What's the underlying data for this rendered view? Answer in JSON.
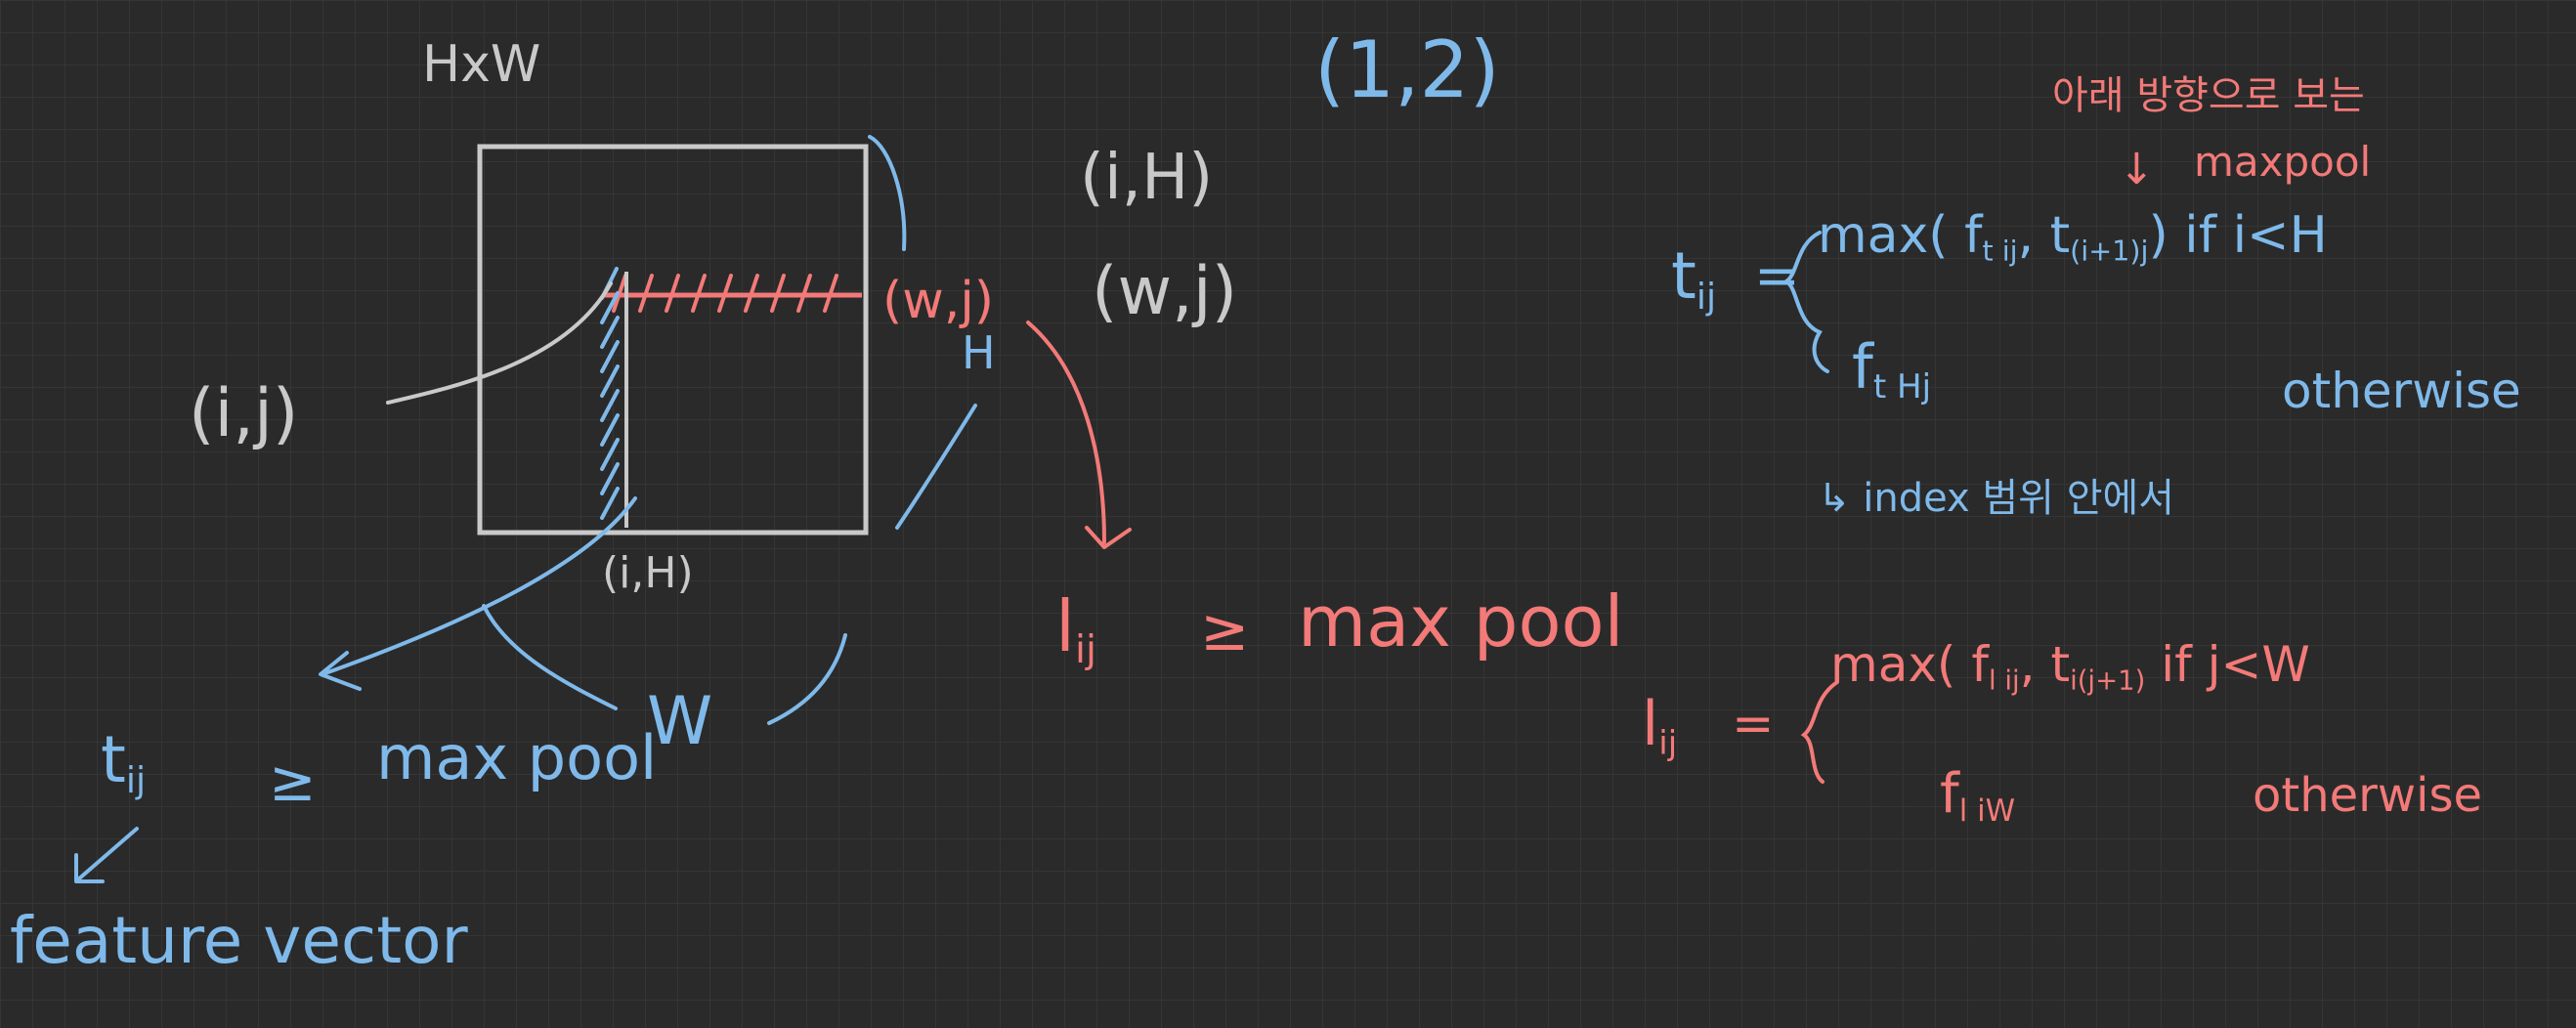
{
  "colors": {
    "background": "#2a2a2a",
    "grid": "#353535",
    "gray_ink": "#c9c9c9",
    "blue_ink": "#7fb9ea",
    "red_ink": "#f27a78"
  },
  "labels": {
    "hxw": "HxW",
    "pair_12": "(1,2)",
    "pair_iH_top": "(i,H)",
    "pair_wj_right": "(w,j)",
    "pair_ij_left": "(i,j)",
    "pair_wj_box": "(w,j)",
    "H_side": "H",
    "pair_iH_bottom": "(i,H)",
    "W_bottom": "W",
    "left_lhs": "t",
    "left_sub": "ij",
    "left_eq": "≥",
    "left_rhs": "max pool",
    "feature_vector": "feature vector",
    "mid_lhs": "l",
    "mid_sub": "ij",
    "mid_eq": "≥",
    "mid_rhs": "max pool"
  },
  "equation_t": {
    "lhs": "t",
    "lhs_sub": "ij",
    "eq": "=",
    "case1_max": "max(",
    "case1_f": "f",
    "case1_f_sub": "t ij",
    "case1_comma": ",",
    "case1_t": "t",
    "case1_t_sub": "(i+1)j",
    "case1_close": ")",
    "case1_cond": "if i<H",
    "case2_f": "f",
    "case2_f_sub": "t Hj",
    "case2_cond": "otherwise",
    "note": "↳ index 범위 안에서"
  },
  "annotation_top": {
    "line1": "아래 방향으로 보는",
    "arrow": "↓",
    "line2": "maxpool"
  },
  "equation_l": {
    "lhs": "l",
    "lhs_sub": "ij",
    "eq": "=",
    "case1_max": "max(",
    "case1_f": "f",
    "case1_f_sub": "l ij",
    "case1_comma": ",",
    "case1_t": "t",
    "case1_t_sub": "i(j+1)",
    "case1_cond": "if j<W",
    "case2_f": "f",
    "case2_f_sub": "l iW",
    "case2_cond": "otherwise"
  }
}
